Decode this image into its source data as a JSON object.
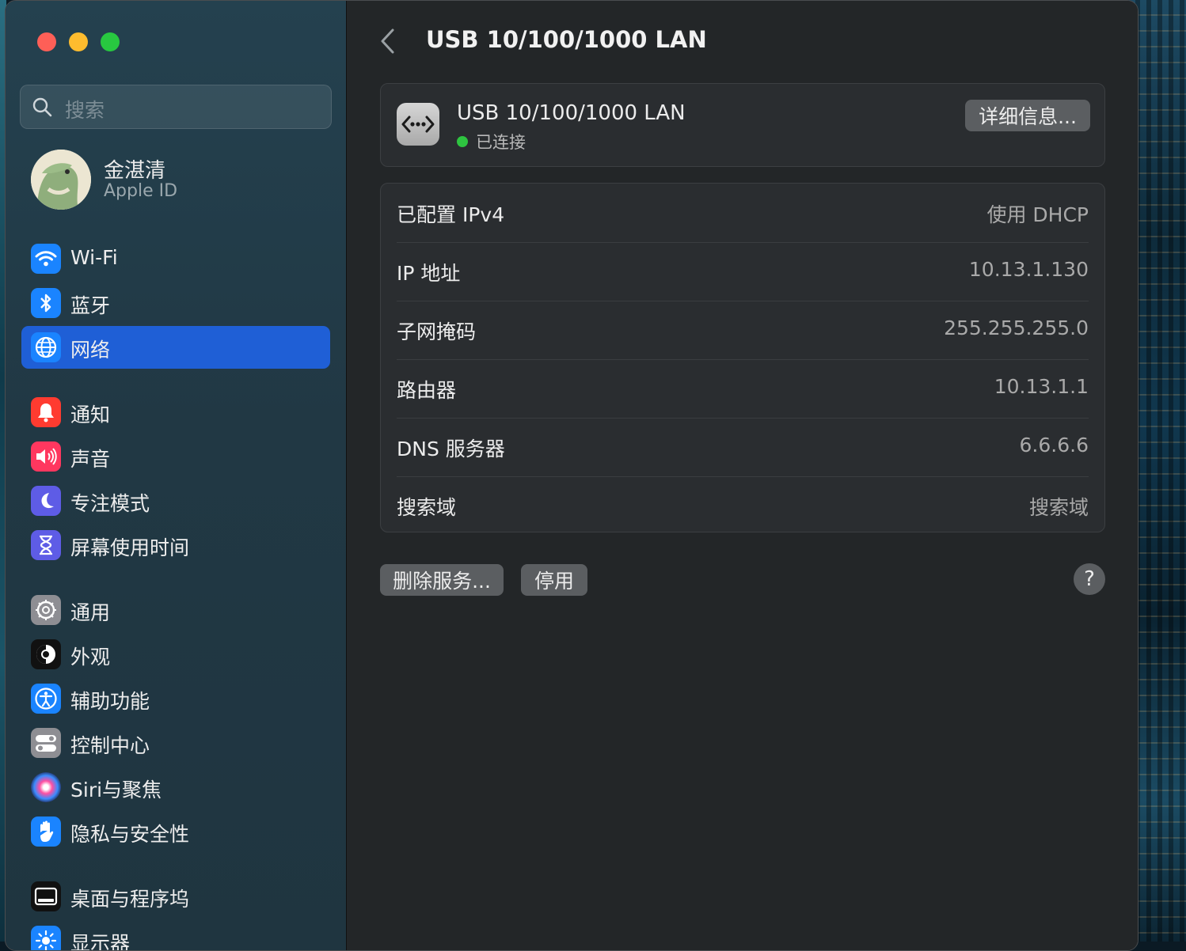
{
  "sidebar": {
    "search_placeholder": "搜索",
    "account": {
      "name": "金湛清",
      "subtitle": "Apple ID"
    },
    "items": [
      {
        "label": "Wi-Fi",
        "icon": "wifi-icon",
        "color": "#1a84ff"
      },
      {
        "label": "蓝牙",
        "icon": "bluetooth-icon",
        "color": "#1a84ff"
      },
      {
        "label": "网络",
        "icon": "globe-icon",
        "color": "#1a84ff",
        "selected": true
      },
      {
        "label": "通知",
        "icon": "bell-icon",
        "color": "#ff3b30"
      },
      {
        "label": "声音",
        "icon": "speaker-icon",
        "color": "#ff375f"
      },
      {
        "label": "专注模式",
        "icon": "moon-icon",
        "color": "#5e5ce6"
      },
      {
        "label": "屏幕使用时间",
        "icon": "hourglass-icon",
        "color": "#5e5ce6"
      },
      {
        "label": "通用",
        "icon": "gear-icon",
        "color": "#8e8e93"
      },
      {
        "label": "外观",
        "icon": "appearance-icon",
        "color": "#111111"
      },
      {
        "label": "辅助功能",
        "icon": "accessibility-icon",
        "color": "#1a84ff"
      },
      {
        "label": "控制中心",
        "icon": "toggles-icon",
        "color": "#8e8e93"
      },
      {
        "label": "Siri与聚焦",
        "icon": "siri-icon",
        "color": "#6b3fd6"
      },
      {
        "label": "隐私与安全性",
        "icon": "hand-icon",
        "color": "#1a84ff"
      },
      {
        "label": "桌面与程序坞",
        "icon": "dock-icon",
        "color": "#111111"
      },
      {
        "label": "显示器",
        "icon": "sun-icon",
        "color": "#1a84ff"
      }
    ]
  },
  "main": {
    "title": "USB 10/100/1000 LAN",
    "service": {
      "name": "USB 10/100/1000 LAN",
      "status": "已连接",
      "status_color": "#2ec440",
      "details_button": "详细信息..."
    },
    "rows": [
      {
        "label": "已配置 IPv4",
        "value": "使用 DHCP"
      },
      {
        "label": "IP 地址",
        "value": "10.13.1.130"
      },
      {
        "label": "子网掩码",
        "value": "255.255.255.0"
      },
      {
        "label": "路由器",
        "value": "10.13.1.1"
      },
      {
        "label": "DNS 服务器",
        "value": "6.6.6.6"
      },
      {
        "label": "搜索域",
        "value": "搜索域"
      }
    ],
    "delete_button": "删除服务...",
    "disable_button": "停用",
    "help_button": "?"
  }
}
